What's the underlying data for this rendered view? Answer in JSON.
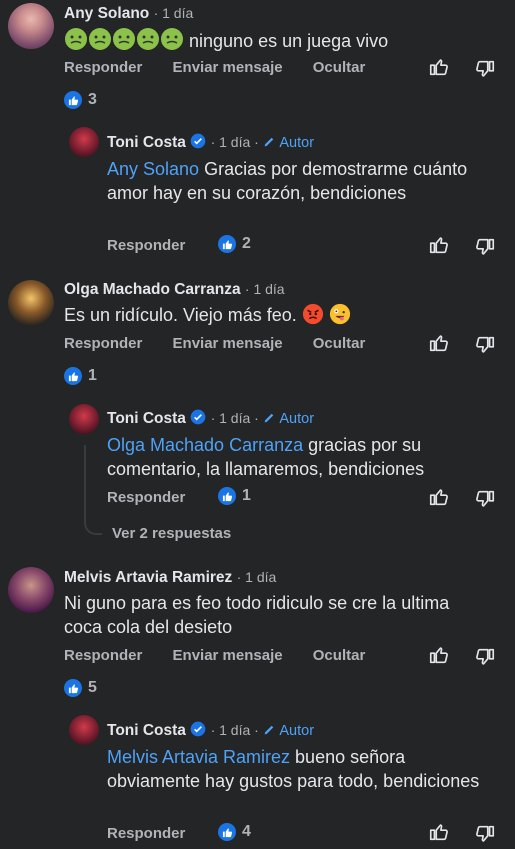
{
  "comments": [
    {
      "author": "Any Solano",
      "time": "· 1 día",
      "text": "ninguno es un juega vivo",
      "emoji_prefix": [
        "nauseated-face-icon",
        "nauseated-face-icon",
        "nauseated-face-icon",
        "nauseated-face-icon",
        "nauseated-face-icon"
      ],
      "actions": {
        "reply": "Responder",
        "message": "Enviar mensaje",
        "hide": "Ocultar"
      },
      "likes": "3",
      "reply": {
        "author": "Toni Costa",
        "time": "· 1 día ·",
        "author_badge": "Autor",
        "mention": "Any Solano",
        "text": " Gracias por demostrarme cuánto amor hay en su corazón, bendiciones",
        "reply_label": "Responder",
        "likes": "2"
      }
    },
    {
      "author": "Olga Machado Carranza",
      "time": "· 1 día",
      "text": "Es un ridículo. Viejo más feo.",
      "emoji_suffix": [
        "angry-face-icon",
        "zany-face-icon"
      ],
      "actions": {
        "reply": "Responder",
        "message": "Enviar mensaje",
        "hide": "Ocultar"
      },
      "likes": "1",
      "reply": {
        "author": "Toni Costa",
        "time": "· 1 día ·",
        "author_badge": "Autor",
        "mention": "Olga Machado Carranza",
        "text": " gracias por su comentario, la llamaremos, bendiciones",
        "reply_label": "Responder",
        "likes": "1"
      },
      "more_replies": "Ver 2 respuestas"
    },
    {
      "author": "Melvis Artavia Ramirez",
      "time": "· 1 día",
      "text": "Ni guno  para es feo todo ridiculo se cre la ultima coca cola del desieto",
      "actions": {
        "reply": "Responder",
        "message": "Enviar mensaje",
        "hide": "Ocultar"
      },
      "likes": "5",
      "reply": {
        "author": "Toni Costa",
        "time": "· 1 día ·",
        "author_badge": "Autor",
        "mention": "Melvis Artavia Ramirez",
        "text": " bueno señora obviamente hay gustos para todo, bendiciones",
        "reply_label": "Responder",
        "likes": "4"
      }
    }
  ],
  "colors": {
    "background": "#242526",
    "link": "#4ea2f7",
    "like": "#1b74e4",
    "muted": "#b0b3b8",
    "text": "#e4e6eb"
  }
}
